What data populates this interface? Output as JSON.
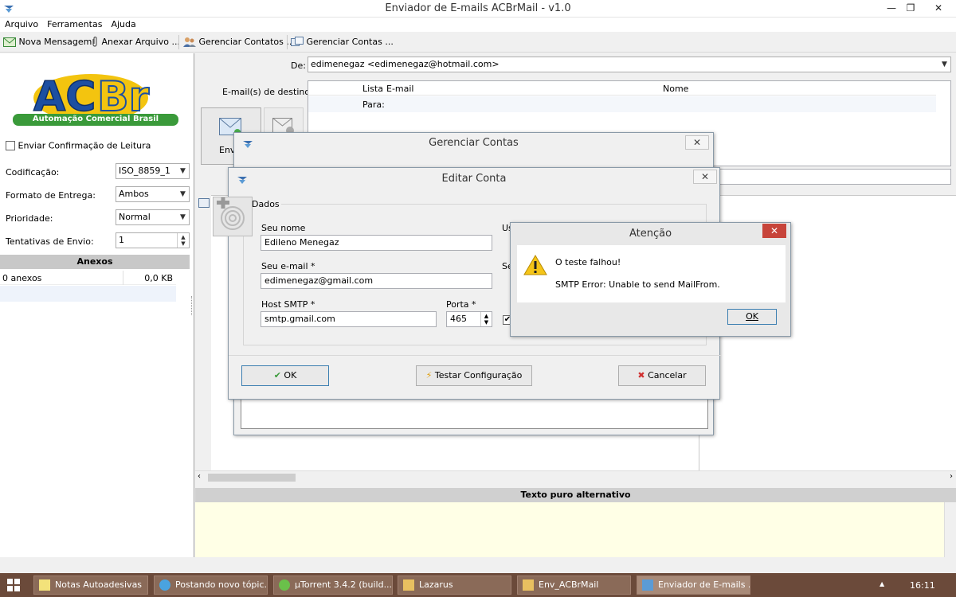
{
  "window": {
    "title": "Enviador de E-mails ACBrMail - v1.0",
    "minimize": "—",
    "restore": "❐",
    "close": "✕"
  },
  "menu": [
    "Arquivo",
    "Ferramentas",
    "Ajuda"
  ],
  "toolbar": {
    "new_message": "Nova Mensagem",
    "attach_file": "Anexar Arquivo ...",
    "manage_contacts": "Gerenciar Contatos ...",
    "manage_accounts": "Gerenciar Contas ..."
  },
  "logo": {
    "text": "ACBr",
    "tagline": "Automação Comercial Brasil"
  },
  "left": {
    "read_confirmation": "Enviar Confirmação de Leitura",
    "encoding_label": "Codificação:",
    "encoding_value": "ISO_8859_1",
    "delivery_label": "Formato de Entrega:",
    "delivery_value": "Ambos",
    "priority_label": "Prioridade:",
    "priority_value": "Normal",
    "attempts_label": "Tentativas de Envio:",
    "attempts_value": "1",
    "attachments_header": "Anexos",
    "attachments_count": "0 anexos",
    "attachments_size": "0,0 KB"
  },
  "compose": {
    "from_label": "De:",
    "from_value": "edimenegaz <edimenegaz@hotmail.com>",
    "dest_label": "E-mail(s) de destino:",
    "col_list": "Lista",
    "col_email": "E-mail",
    "col_name": "Nome",
    "row_to": "Para:",
    "send_label": "Env",
    "plain_text_header": "Texto puro alternativo"
  },
  "gerenciar_contas": {
    "title": "Gerenciar Contas",
    "close": "✕"
  },
  "editar_conta": {
    "title": "Editar Conta",
    "close": "✕",
    "group_label": "Dados",
    "name_label": "Seu nome",
    "name_value": "Edileno Menegaz",
    "email_label": "Seu e-mail *",
    "email_value": "edimenegaz@gmail.com",
    "host_label": "Host SMTP *",
    "host_value": "smtp.gmail.com",
    "port_label": "Porta *",
    "port_value": "465",
    "user_label_partial": "Us",
    "pass_label_partial": "Se",
    "ok": "OK",
    "test": "Testar Configuração",
    "cancel": "Cancelar"
  },
  "atencao": {
    "title": "Atenção",
    "close": "✕",
    "line1": "O teste falhou!",
    "line2": "SMTP Error: Unable to send MailFrom.",
    "ok": "OK"
  },
  "taskbar": {
    "items": [
      "Notas Autoadesivas",
      "Postando novo tópic...",
      "µTorrent 3.4.2  (build...",
      "Lazarus",
      "Env_ACBrMail",
      "Enviador de E-mails ..."
    ],
    "clock": "16:11",
    "tray_arrow": "▲"
  },
  "colors": {
    "accent_red": "#c7443a",
    "logo_blue": "#1c4fa1",
    "logo_yellow": "#f3c40f",
    "logo_green": "#3a9a3a",
    "taskbar": "#6b4a3a",
    "plain_text_bg": "#ffffe6"
  }
}
